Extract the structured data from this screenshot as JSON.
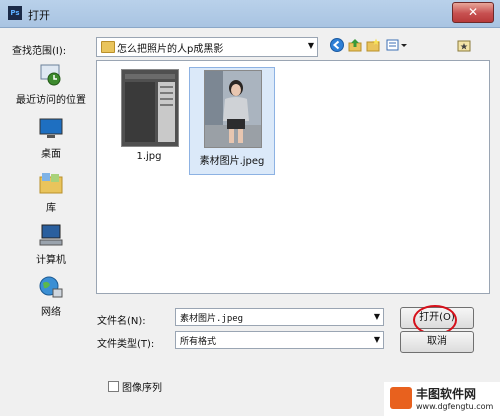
{
  "window": {
    "title": "打开",
    "app_icon_text": "Ps"
  },
  "lookin": {
    "label": "查找范围(I):",
    "value": "怎么把照片的人p成黑影"
  },
  "places": [
    {
      "label": "最近访问的位置",
      "icon": "recent-places-icon"
    },
    {
      "label": "桌面",
      "icon": "desktop-icon"
    },
    {
      "label": "库",
      "icon": "libraries-icon"
    },
    {
      "label": "计算机",
      "icon": "computer-icon"
    },
    {
      "label": "网络",
      "icon": "network-icon"
    }
  ],
  "files": [
    {
      "name": "1.jpg",
      "selected": false
    },
    {
      "name": "素材图片.jpeg",
      "selected": true
    }
  ],
  "filename": {
    "label": "文件名(N):",
    "value": "素材图片.jpeg"
  },
  "filetype": {
    "label": "文件类型(T):",
    "value": "所有格式"
  },
  "buttons": {
    "open": "打开(O)",
    "cancel": "取消"
  },
  "image_sequence": {
    "label": "图像序列",
    "checked": false
  },
  "watermark": {
    "title": "丰图软件网",
    "url": "www.dgfengtu.com"
  }
}
